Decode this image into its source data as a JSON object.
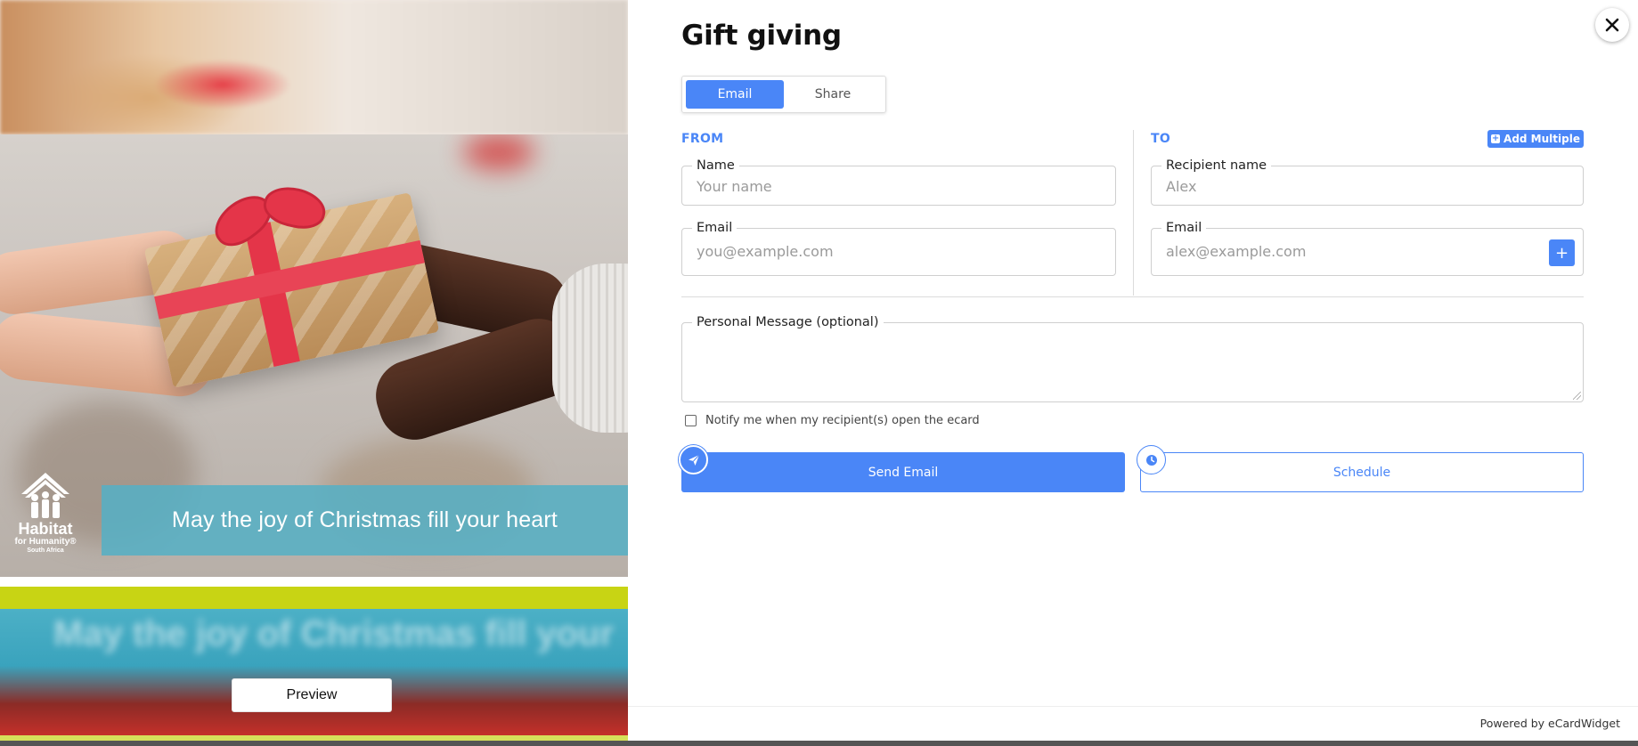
{
  "preview": {
    "banner_text": "May the joy of Christmas fill your heart",
    "blurred_text": "May the joy of Christmas fill your",
    "logo": {
      "line1": "Habitat",
      "line2": "for Humanity®",
      "line3": "South Africa"
    },
    "preview_button": "Preview"
  },
  "dialog": {
    "title": "Gift giving",
    "tabs": [
      {
        "label": "Email",
        "active": true
      },
      {
        "label": "Share",
        "active": false
      }
    ],
    "from": {
      "label": "FROM",
      "name_legend": "Name",
      "name_placeholder": "Your name",
      "email_legend": "Email",
      "email_placeholder": "you@example.com"
    },
    "to": {
      "label": "TO",
      "add_multiple": "Add Multiple",
      "name_legend": "Recipient name",
      "name_placeholder": "Alex",
      "email_legend": "Email",
      "email_placeholder": "alex@example.com",
      "add_recipient": "+"
    },
    "message": {
      "legend": "Personal Message (optional)",
      "placeholder": ""
    },
    "notify_label": "Notify me when my recipient(s) open the ecard",
    "send_button": "Send Email",
    "schedule_button": "Schedule",
    "footer": "Powered by eCardWidget"
  },
  "colors": {
    "accent": "#4a86f7",
    "banner": "#57afc4",
    "lime": "#c8d414",
    "ribbon": "#e43549"
  },
  "icons": [
    "close-icon",
    "plus-icon",
    "send-icon",
    "clock-icon",
    "habitat-logo-icon"
  ]
}
